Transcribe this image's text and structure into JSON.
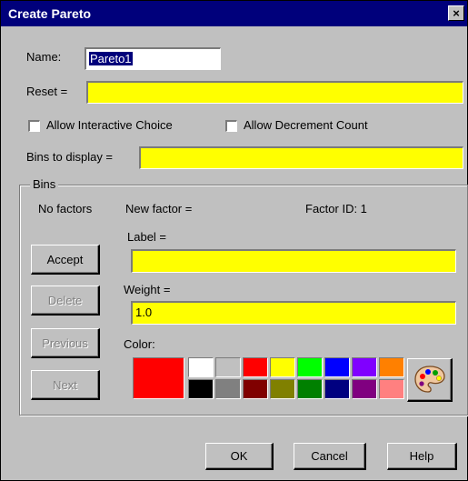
{
  "window": {
    "title": "Create Pareto",
    "close_label": "×"
  },
  "form": {
    "name_label": "Name:",
    "name_value": "Pareto1",
    "reset_label": "Reset =",
    "reset_value": "",
    "allow_interactive_label": "Allow Interactive Choice",
    "allow_decrement_label": "Allow Decrement Count",
    "bins_to_display_label": "Bins to display =",
    "bins_to_display_value": ""
  },
  "bins": {
    "group_title": "Bins",
    "no_factors": "No factors",
    "new_factor": "New factor =",
    "factor_id": "Factor ID:  1",
    "label_label": "Label =",
    "label_value": "",
    "weight_label": "Weight =",
    "weight_value": "1.0",
    "color_label": "Color:",
    "buttons": {
      "accept": "Accept",
      "delete": "Delete",
      "previous": "Previous",
      "next": "Next"
    },
    "selected_color": "#ff0000",
    "palette": [
      [
        "#ffffff",
        "#c0c0c0",
        "#ff0000",
        "#ffff00",
        "#00ff00",
        "#0000ff",
        "#8000ff",
        "#ff8000"
      ],
      [
        "#000000",
        "#808080",
        "#800000",
        "#808000",
        "#008000",
        "#000080",
        "#800080",
        "#ff8080"
      ]
    ],
    "palette_button_icon": "paint-palette-icon"
  },
  "footer": {
    "ok": "OK",
    "cancel": "Cancel",
    "help": "Help"
  }
}
